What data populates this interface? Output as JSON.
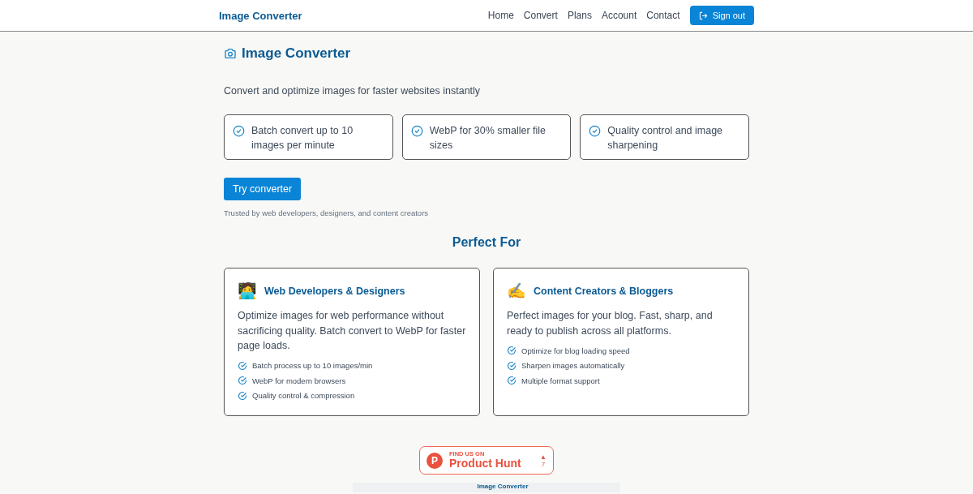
{
  "nav": {
    "brand": "Image Converter",
    "links": [
      "Home",
      "Convert",
      "Plans",
      "Account",
      "Contact"
    ],
    "sign_out": "Sign out"
  },
  "hero": {
    "title": "Image Converter",
    "subtitle": "Convert and optimize images for faster websites instantly",
    "features": [
      "Batch convert up to 10 images per minute",
      "WebP for 30% smaller file sizes",
      "Quality control and image sharpening"
    ],
    "cta": "Try converter",
    "trust": "Trusted by web developers, designers, and content creators"
  },
  "perfect_for": {
    "heading": "Perfect For",
    "cards": [
      {
        "emoji": "🧑‍💻",
        "title": "Web Developers & Designers",
        "text": "Optimize images for web performance without sacrificing quality. Batch convert to WebP for faster page loads.",
        "points": [
          "Batch process up to 10 images/min",
          "WebP for modern browsers",
          "Quality control & compression"
        ]
      },
      {
        "emoji": "✍️",
        "title": "Content Creators & Bloggers",
        "text": "Perfect images for your blog. Fast, sharp, and ready to publish across all platforms.",
        "points": [
          "Optimize for blog loading speed",
          "Sharpen images automatically",
          "Multiple format support"
        ]
      }
    ]
  },
  "badge": {
    "kicker": "FIND US ON",
    "name": "Product Hunt",
    "letter": "P",
    "arrow": "▲",
    "votes": "7"
  },
  "preview": {
    "title": "Image Converter"
  }
}
